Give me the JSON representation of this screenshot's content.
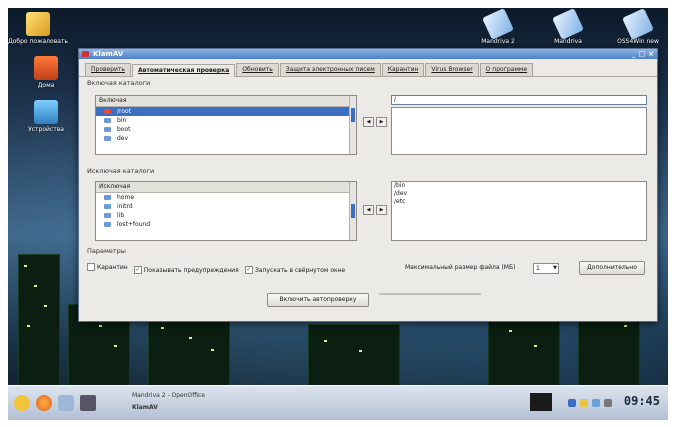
{
  "desktop": {
    "icons": [
      {
        "label": "Добро пожаловать",
        "icon": "welcome-icon"
      },
      {
        "label": "Дома",
        "icon": "home-icon"
      },
      {
        "label": "Устройства",
        "icon": "devices-icon"
      },
      {
        "label": "Mandriva 2",
        "icon": "mandriva-icon"
      },
      {
        "label": "Mandriva",
        "icon": "mandriva-icon"
      },
      {
        "label": "OSS4Win new",
        "icon": "mandriva-icon"
      }
    ]
  },
  "window": {
    "title": "KlamAV",
    "controls": [
      "_",
      "□",
      "×"
    ],
    "tabs": [
      {
        "label": "Проверить",
        "active": false
      },
      {
        "label": "Автоматическая проверка",
        "active": true
      },
      {
        "label": "Обновить",
        "active": false
      },
      {
        "label": "Защита электронных писем",
        "active": false
      },
      {
        "label": "Карантин",
        "active": false
      },
      {
        "label": "Virus Browser",
        "active": false
      },
      {
        "label": "О программе",
        "active": false
      }
    ],
    "include": {
      "group_label": "Включая каталоги",
      "tree_header": "Включая",
      "tree_items": [
        "/root",
        "bin",
        "boot",
        "dev"
      ],
      "selected_item": "/root",
      "path_value": "/"
    },
    "exclude": {
      "group_label": "Исключая каталоги",
      "tree_header": "Исключая",
      "tree_items": [
        "home",
        "initrd",
        "lib",
        "lost+found"
      ],
      "list": [
        "/bin",
        "/dev",
        "/etc"
      ]
    },
    "params": {
      "group_label": "Параметры",
      "options": [
        {
          "label": "Карантин",
          "checked": false
        },
        {
          "label": "Показывать предупреждения",
          "checked": true
        },
        {
          "label": "Запускать в свёрнутом окне",
          "checked": true
        }
      ],
      "max_size_label": "Максимальный размер файла (МБ)",
      "max_size_value": "1",
      "advanced_button": "Дополнительно"
    },
    "buttons": {
      "enable": "Включить автопроверку",
      "disabled_placeholder": ""
    }
  },
  "taskbar": {
    "tasks": [
      {
        "label": "Mandriva 2 - OpenOffice"
      },
      {
        "label": "KlamAV"
      }
    ],
    "clock": "09:45"
  }
}
